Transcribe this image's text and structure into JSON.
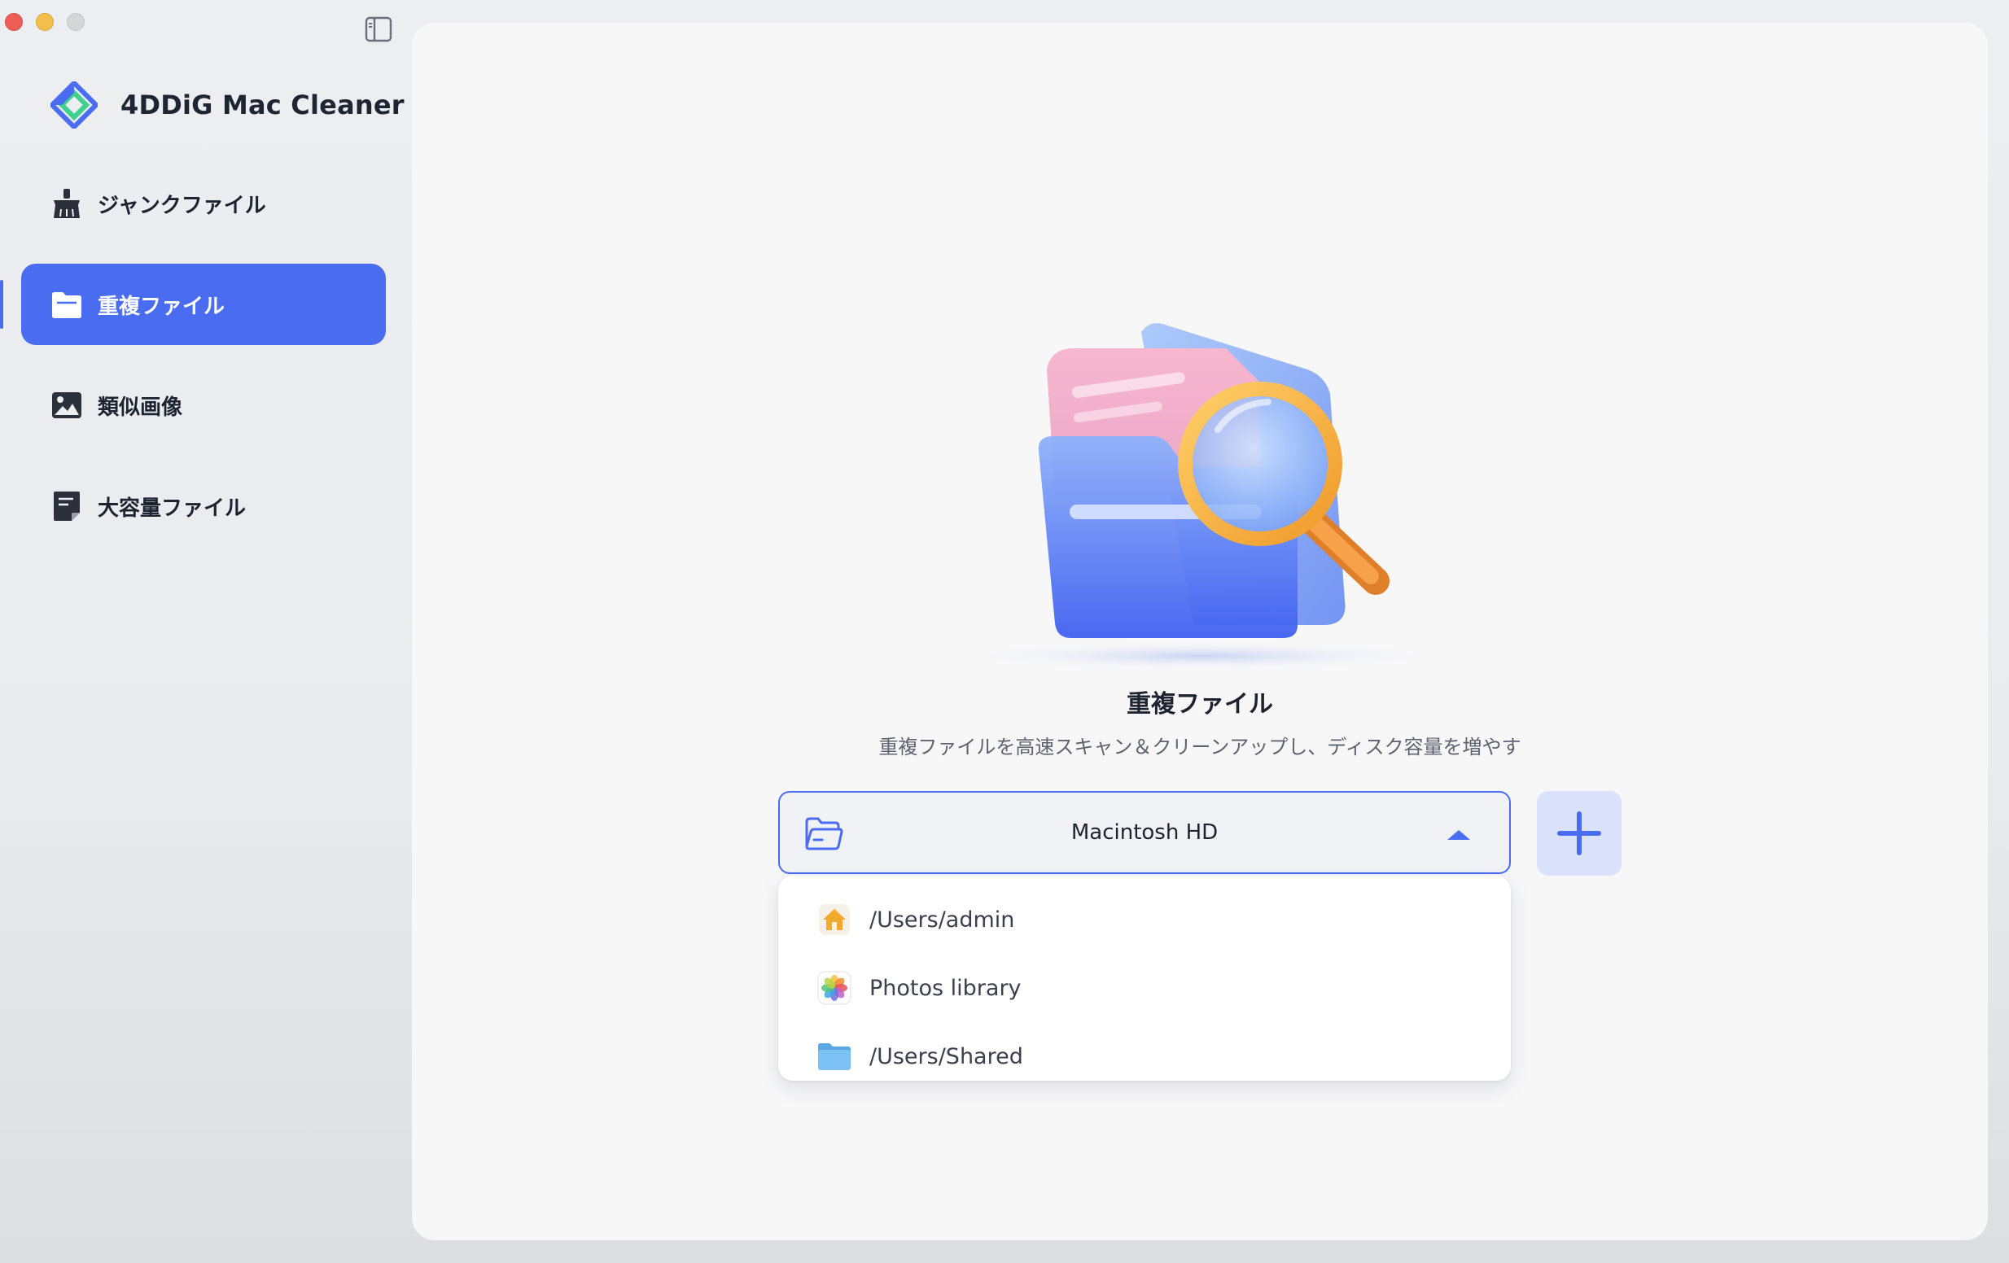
{
  "app": {
    "name": "4DDiG Mac Cleaner"
  },
  "sidebar": {
    "items": [
      {
        "label": "ジャンクファイル",
        "icon": "broom-icon",
        "active": false
      },
      {
        "label": "重複ファイル",
        "icon": "folder-icon",
        "active": true
      },
      {
        "label": "類似画像",
        "icon": "image-icon",
        "active": false
      },
      {
        "label": "大容量ファイル",
        "icon": "document-icon",
        "active": false
      }
    ]
  },
  "main": {
    "title": "重複ファイル",
    "subtitle": "重複ファイルを高速スキャン＆クリーンアップし、ディスク容量を増やす",
    "location_select": {
      "value": "Macintosh HD",
      "options": [
        {
          "label": "/Users/admin",
          "icon": "home-folder-icon"
        },
        {
          "label": "Photos library",
          "icon": "photos-icon"
        },
        {
          "label": "/Users/Shared",
          "icon": "blue-folder-icon"
        }
      ]
    },
    "add_button": {
      "icon": "plus-icon"
    }
  },
  "colors": {
    "accent": "#4a6cf0",
    "sidebar_bg": "#eceef1",
    "panel_bg": "#f7f7f8"
  }
}
